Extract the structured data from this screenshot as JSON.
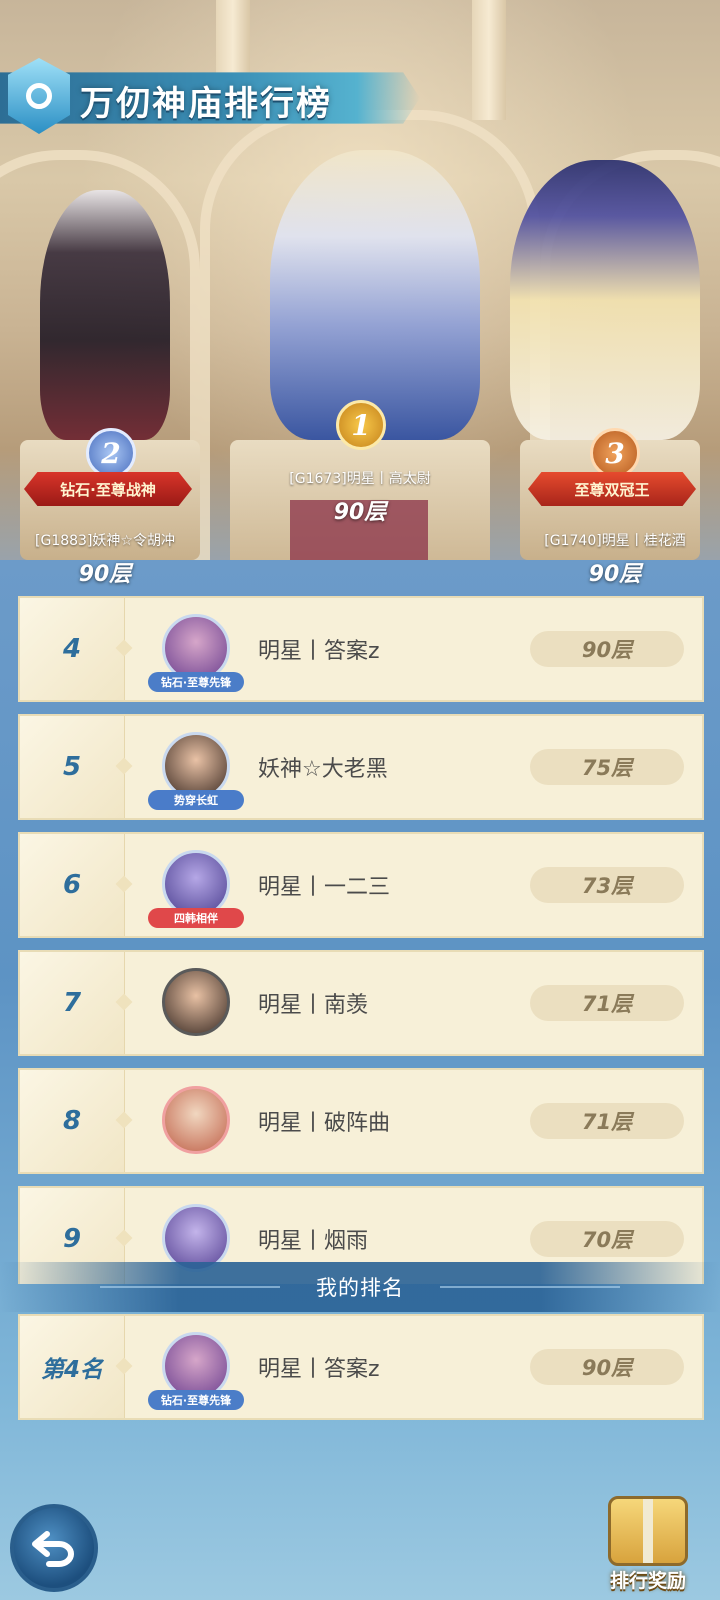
{
  "header": {
    "title": "万仞神庙排行榜"
  },
  "podium": [
    {
      "rank": "1",
      "title_badge": "",
      "name": "[G1673]明星丨高太尉",
      "floor": "90层"
    },
    {
      "rank": "2",
      "title_badge": "钻石·至尊战神",
      "name": "[G1883]妖神☆令胡冲",
      "floor": "90层"
    },
    {
      "rank": "3",
      "title_badge": "至尊双冠王",
      "name": "[G1740]明星丨桂花酒",
      "floor": "90层"
    }
  ],
  "ranking_list": [
    {
      "rank": "4",
      "name": "明星丨答案z",
      "frame_label": "钻石·至尊先锋",
      "floor": "90层"
    },
    {
      "rank": "5",
      "name": "妖神☆大老黑",
      "frame_label": "势穿长虹",
      "floor": "75层"
    },
    {
      "rank": "6",
      "name": "明星丨一二三",
      "frame_label": "四韩相伴",
      "floor": "73层"
    },
    {
      "rank": "7",
      "name": "明星丨南羡",
      "frame_label": "",
      "floor": "71层"
    },
    {
      "rank": "8",
      "name": "明星丨破阵曲",
      "frame_label": "",
      "floor": "71层"
    },
    {
      "rank": "9",
      "name": "明星丨烟雨",
      "frame_label": "",
      "floor": "70层"
    }
  ],
  "my_ranking": {
    "header": "我的排名",
    "rank": "第4名",
    "name": "明星丨答案z",
    "frame_label": "钻石·至尊先锋",
    "floor": "90层"
  },
  "footer": {
    "back_icon": "back-arrow-icon",
    "reward_label": "排行奖励"
  }
}
